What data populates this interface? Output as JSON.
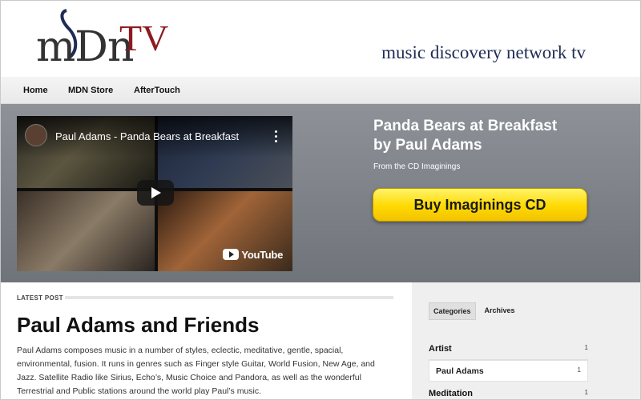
{
  "site": {
    "logo_text": "mDnTV",
    "tagline": "music discovery network tv"
  },
  "nav": {
    "items": [
      {
        "label": "Home"
      },
      {
        "label": "MDN Store"
      },
      {
        "label": "AfterTouch"
      }
    ]
  },
  "hero": {
    "video": {
      "title": "Paul Adams - Panda Bears at Breakfast",
      "brand": "YouTube"
    },
    "title_line1": "Panda Bears at Breakfast",
    "title_line2": "by Paul Adams",
    "subtitle": "From the CD Imaginings",
    "buy_button": "Buy Imaginings CD",
    "colors": {
      "button": "#ffd900",
      "band": "#7f838a"
    }
  },
  "main": {
    "section_label": "LATEST POST",
    "post_title": "Paul Adams and Friends",
    "post_body": "Paul Adams composes music in a number of styles, eclectic, meditative, gentle, spacial, environmental, fusion. It runs in genres such as Finger style Guitar, World Fusion, New Age, and Jazz. Satellite Radio like Sirius, Echo’s, Music Choice and Pandora, as well as the wonderful Terrestrial and Public stations around the world play Paul’s music."
  },
  "sidebar": {
    "tabs": [
      {
        "label": "Categories",
        "active": true
      },
      {
        "label": "Archives",
        "active": false
      }
    ],
    "categories": [
      {
        "label": "Artist",
        "count": "1"
      },
      {
        "label": "Paul Adams",
        "count": "1",
        "sub": true
      },
      {
        "label": "Meditation",
        "count": "1"
      }
    ]
  },
  "icons": {
    "play": "play-icon",
    "menu": "kebab-menu-icon",
    "youtube": "youtube-logo-icon"
  }
}
